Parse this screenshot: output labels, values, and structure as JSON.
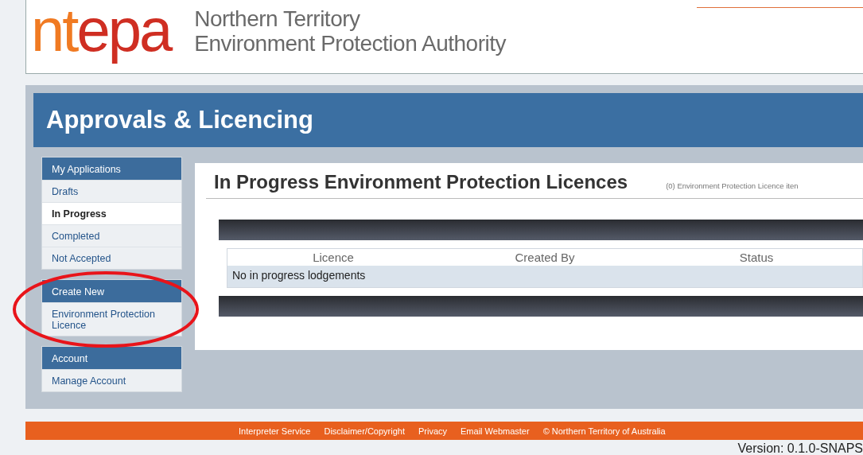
{
  "header": {
    "logo": {
      "part_1": "nt",
      "part_2": "epa"
    },
    "org_line_1": "Northern Territory",
    "org_line_2": "Environment Protection Authority"
  },
  "banner": {
    "title": "Approvals & Licencing"
  },
  "sidebar": {
    "sections": [
      {
        "title": "My Applications",
        "items": [
          {
            "label": "Drafts",
            "selected": false
          },
          {
            "label": "In Progress",
            "selected": true
          },
          {
            "label": "Completed",
            "selected": false
          },
          {
            "label": "Not Accepted",
            "selected": false
          }
        ]
      },
      {
        "title": "Create New",
        "items": [
          {
            "label": "Environment Protection Licence",
            "selected": false
          }
        ]
      },
      {
        "title": "Account",
        "items": [
          {
            "label": "Manage Account",
            "selected": false
          }
        ]
      }
    ]
  },
  "content": {
    "title": "In Progress Environment Protection Licences",
    "count_note": "(0) Environment Protection Licence iten",
    "table": {
      "columns": [
        "Licence",
        "Created By",
        "Status"
      ],
      "empty_message": "No in progress lodgements"
    }
  },
  "footer": {
    "links": [
      "Interpreter Service",
      "Disclaimer/Copyright",
      "Privacy",
      "Email Webmaster",
      "© Northern Territory of Australia"
    ],
    "version": "Version: 0.1.0-SNAPS"
  }
}
